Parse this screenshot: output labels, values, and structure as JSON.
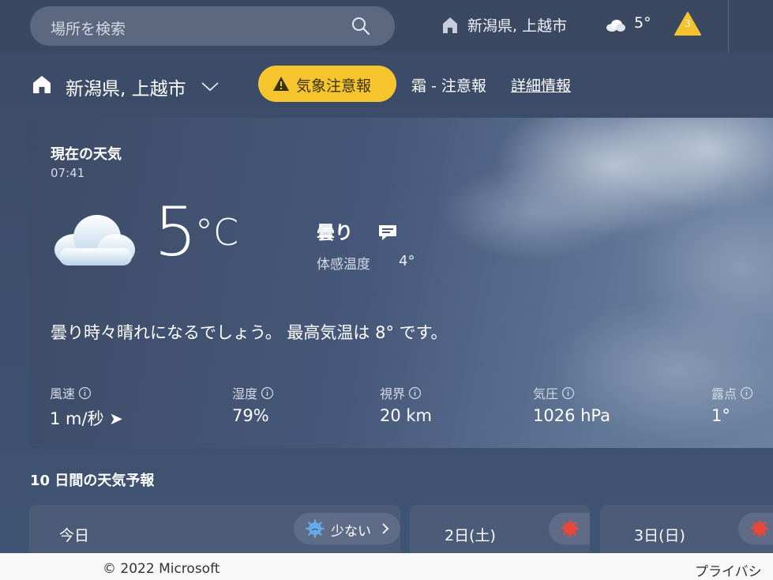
{
  "topbar": {
    "search_placeholder": "場所を検索",
    "location": "新潟県, 上越市",
    "temperature": "5°",
    "alert_count": "3",
    "icons": [
      "search-icon",
      "home-icon",
      "cloud-icon",
      "warning-icon"
    ]
  },
  "location_bar": {
    "location": "新潟県, 上越市",
    "alert_label": "気象注意報",
    "alert_text": "霜 - 注意報",
    "details_link": "詳細情報"
  },
  "current": {
    "title": "現在の天気",
    "time": "07:41",
    "temperature": "5",
    "unit": "°C",
    "condition": "曇り",
    "feels_like_label": "体感温度",
    "feels_like_value": "4°",
    "summary": "曇り時々晴れになるでしょう。 最高気温は 8° です。",
    "metrics": [
      {
        "label": "風速",
        "value": "1 m/秒 ➤"
      },
      {
        "label": "湿度",
        "value": "79%"
      },
      {
        "label": "視界",
        "value": "20 km"
      },
      {
        "label": "気圧",
        "value": "1026 hPa"
      },
      {
        "label": "露点",
        "value": "1°"
      }
    ]
  },
  "forecast": {
    "title": "10 日間の天気予報",
    "days": [
      {
        "name": "今日",
        "pollen": "少ない"
      },
      {
        "name": "2日(土)",
        "pollen": ""
      },
      {
        "name": "3日(日)",
        "pollen": ""
      }
    ]
  },
  "footer": {
    "copyright": "© 2022 Microsoft",
    "privacy": "プライバシ"
  },
  "colors": {
    "alert_yellow": "#f6c42d",
    "background": "#3e4f6c",
    "pollen_low": "#6aa9e6",
    "pollen_high": "#e8483a"
  }
}
